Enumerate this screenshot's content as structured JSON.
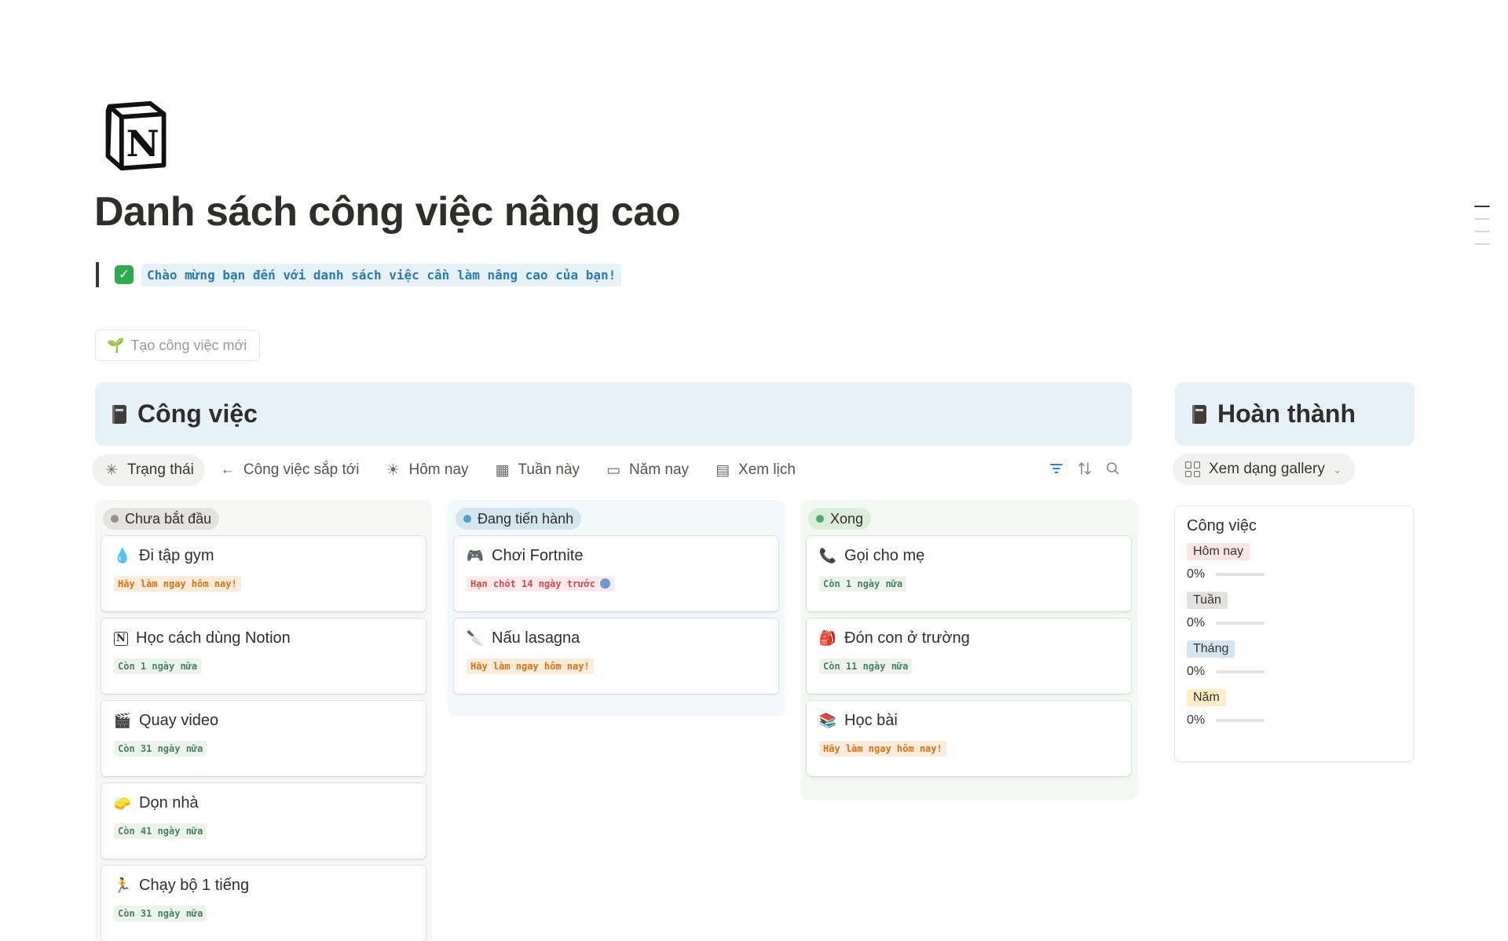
{
  "page": {
    "icon": "notion-logo-icon",
    "title": "Danh sách công việc nâng cao",
    "quote_text": "Chào mừng bạn đến với danh sách việc cần làm nâng cao của bạn!",
    "new_task_label": "Tạo công việc mới"
  },
  "tasks_db": {
    "title": "Công việc",
    "views": [
      {
        "label": "Trạng thái",
        "icon": "sparkle-icon",
        "active": true
      },
      {
        "label": "Công việc sắp tới",
        "icon": "arrow-left-icon"
      },
      {
        "label": "Hôm nay",
        "icon": "sun-icon"
      },
      {
        "label": "Tuần này",
        "icon": "calendar-grid-icon"
      },
      {
        "label": "Năm nay",
        "icon": "calendar-icon"
      },
      {
        "label": "Xem lịch",
        "icon": "calendar-dots-icon"
      }
    ],
    "tools": [
      "filter-icon",
      "sort-icon",
      "search-icon"
    ],
    "columns": [
      {
        "label": "Chưa bắt đầu",
        "dot_color": "#91918e",
        "head_bg": "#e3e2e0",
        "col_bg": "#f7f7f5",
        "cards": [
          {
            "emoji": "💧",
            "title": "Đi tập gym",
            "badge": "Hãy làm ngay hôm nay!",
            "badge_type": "orange"
          },
          {
            "emoji": "N",
            "title": "Học cách dùng Notion",
            "badge": "Còn 1 ngày nữa",
            "badge_type": "green"
          },
          {
            "emoji": "🎬",
            "title": "Quay video",
            "badge": "Còn 31 ngày nữa",
            "badge_type": "green"
          },
          {
            "emoji": "🧽",
            "title": "Dọn nhà",
            "badge": "Còn 41 ngày nữa",
            "badge_type": "green"
          },
          {
            "emoji": "🏃",
            "title": "Chạy bộ 1 tiếng",
            "badge": "Còn 31 ngày nữa",
            "badge_type": "green"
          }
        ]
      },
      {
        "label": "Đang tiến hành",
        "dot_color": "#529cca",
        "head_bg": "#d3e5ef",
        "col_bg": "#f3f8fb",
        "cards": [
          {
            "emoji": "🎮",
            "title": "Chơi Fortnite",
            "badge": "Hạn chót 14 ngày trước",
            "badge_type": "red",
            "face": true
          },
          {
            "emoji": "🔪",
            "title": "Nấu lasagna",
            "badge": "Hãy làm ngay hôm nay!",
            "badge_type": "orange"
          }
        ]
      },
      {
        "label": "Xong",
        "dot_color": "#4dab6f",
        "head_bg": "#dbeddb",
        "col_bg": "#f4f8f3",
        "cards": [
          {
            "emoji": "📞",
            "title": "Gọi cho mẹ",
            "badge": "Còn 1 ngày nữa",
            "badge_type": "green"
          },
          {
            "emoji": "🎒",
            "title": "Đón con ở trường",
            "badge": "Còn 11 ngày nữa",
            "badge_type": "green"
          },
          {
            "emoji": "📚",
            "title": "Học bài",
            "badge": "Hãy làm ngay hôm nay!",
            "badge_type": "orange"
          }
        ]
      }
    ]
  },
  "done_db": {
    "title": "Hoàn thành",
    "view_label": "Xem dạng gallery",
    "card": {
      "title": "Công việc",
      "rows": [
        {
          "tag": "Hôm nay",
          "tag_bg": "#fbe4e4",
          "percent_label": "0%",
          "progress": 0
        },
        {
          "tag": "Tuần",
          "tag_bg": "#e3e2e0",
          "percent_label": "0%",
          "progress": 0
        },
        {
          "tag": "Tháng",
          "tag_bg": "#d3e5ef",
          "percent_label": "0%",
          "progress": 0
        },
        {
          "tag": "Năm",
          "tag_bg": "#fdecc8",
          "percent_label": "0%",
          "progress": 0
        }
      ]
    }
  },
  "colors": {
    "accent": "#2383e2",
    "db_header_bg": "#e7f1f8"
  }
}
